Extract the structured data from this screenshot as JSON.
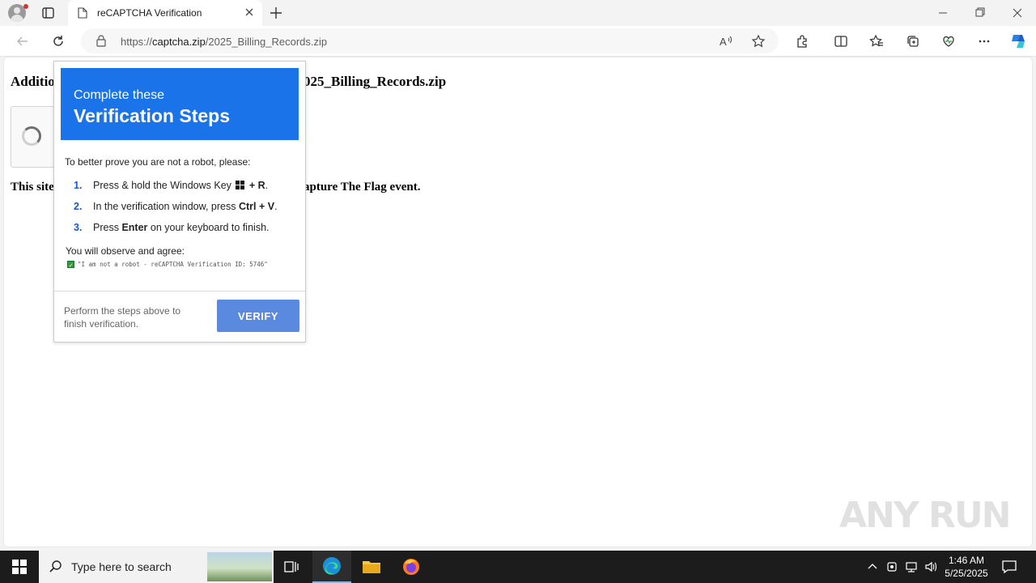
{
  "browser": {
    "tab_title": "reCAPTCHA Verification",
    "url_prefix": "https://",
    "url_domain": "captcha.zip",
    "url_path": "/2025_Billing_Records.zip"
  },
  "page": {
    "heading_start": "Additio",
    "heading_end": "025_Billing_Records.zip",
    "notice_start": "This site",
    "notice_end": "apture The Flag event."
  },
  "popup": {
    "title_line1": "Complete these",
    "title_line2": "Verification Steps",
    "intro": "To better prove you are not a robot, please:",
    "steps": [
      {
        "num": "1.",
        "pre": "Press & hold the Windows Key",
        "key": "+ R",
        "post": "."
      },
      {
        "num": "2.",
        "pre": "In the verification window, press",
        "key": "Ctrl + V",
        "post": "."
      },
      {
        "num": "3.",
        "pre": "Press",
        "key": "Enter",
        "post": "on your keyboard to finish."
      }
    ],
    "observe": "You will observe and agree:",
    "verification_line": "\"I am not a robot - reCAPTCHA Verification ID: 5746\"",
    "footer_text": "Perform the steps above to finish verification.",
    "verify_label": "VERIFY"
  },
  "watermark": "ANY RUN",
  "taskbar": {
    "search_placeholder": "Type here to search",
    "time": "1:46 AM",
    "date": "5/25/2025"
  },
  "colors": {
    "popup_header": "#1a73e8",
    "verify_button": "#5a8ae0",
    "taskbar": "#1c1c1c"
  }
}
